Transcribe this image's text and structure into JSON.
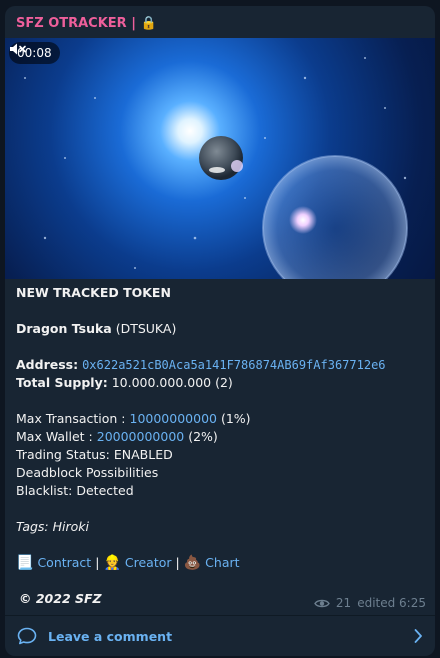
{
  "channel": {
    "name": "SFZ OTRACKER",
    "separator": "|",
    "lock_emoji": "🔒"
  },
  "video": {
    "duration": "00:08",
    "muted": true
  },
  "message": {
    "heading": "NEW TRACKED TOKEN",
    "token_name": "Dragon Tsuka",
    "token_symbol": "(DTSUKA)",
    "address_label": "Address:",
    "address_value": "0x622a521cB0Aca5a141F786874AB69fAf367712e6",
    "supply_label": "Total Supply:",
    "supply_value": "10.000.000.000 (2)",
    "max_tx_label": "Max Transaction :",
    "max_tx_value": "10000000000",
    "max_tx_pct": "(1%)",
    "max_wallet_label": "Max Wallet :",
    "max_wallet_value": "20000000000",
    "max_wallet_pct": "(2%)",
    "trading_status": "Trading Status: ENABLED",
    "deadblock": "Deadblock Possibilities",
    "blacklist": "Blacklist: Detected",
    "tags": "Tags: Hiroki",
    "links": [
      {
        "emoji": "📃",
        "label": "Contract"
      },
      {
        "emoji": "👷",
        "label": "Creator"
      },
      {
        "emoji": "💩",
        "label": "Chart"
      }
    ],
    "link_separator": "|",
    "footer": "© 2022 SFZ"
  },
  "meta": {
    "views": "21",
    "edited": "edited 6:25"
  },
  "comment_bar": {
    "label": "Leave a comment"
  },
  "colors": {
    "accent": "#6ab2f2",
    "channel": "#ee5f9b",
    "card": "#182533",
    "background": "#0e1621"
  }
}
